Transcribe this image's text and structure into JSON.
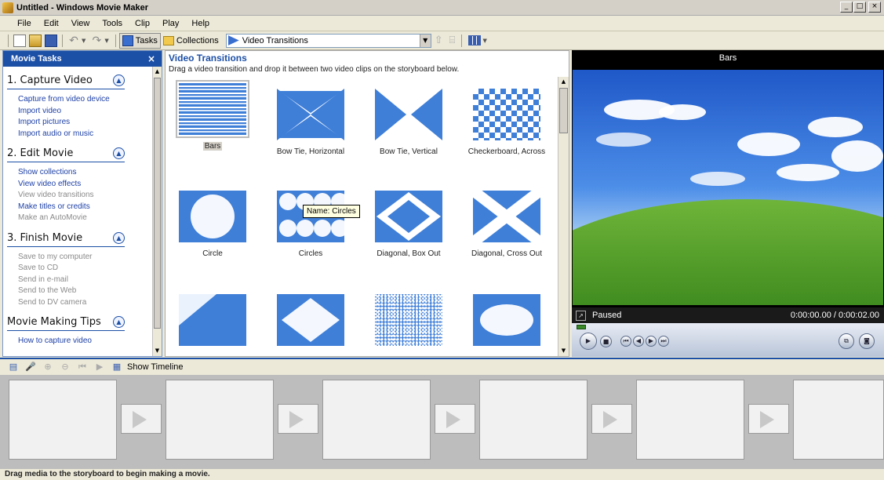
{
  "window": {
    "title": "Untitled - Windows Movie Maker",
    "minimize": "_",
    "maximize": "□",
    "close": "×"
  },
  "menu": [
    "File",
    "Edit",
    "View",
    "Tools",
    "Clip",
    "Play",
    "Help"
  ],
  "toolbar": {
    "tasks_label": "Tasks",
    "collections_label": "Collections",
    "collection_select": "Video Transitions"
  },
  "tasks": {
    "header": "Movie Tasks",
    "close": "×",
    "sections": [
      {
        "title": "1. Capture Video",
        "items": [
          {
            "label": "Capture from video device",
            "enabled": true
          },
          {
            "label": "Import video",
            "enabled": true
          },
          {
            "label": "Import pictures",
            "enabled": true
          },
          {
            "label": "Import audio or music",
            "enabled": true
          }
        ]
      },
      {
        "title": "2. Edit Movie",
        "items": [
          {
            "label": "Show collections",
            "enabled": true
          },
          {
            "label": "View video effects",
            "enabled": true
          },
          {
            "label": "View video transitions",
            "enabled": false
          },
          {
            "label": "Make titles or credits",
            "enabled": true
          },
          {
            "label": "Make an AutoMovie",
            "enabled": false
          }
        ]
      },
      {
        "title": "3. Finish Movie",
        "items": [
          {
            "label": "Save to my computer",
            "enabled": false
          },
          {
            "label": "Save to CD",
            "enabled": false
          },
          {
            "label": "Send in e-mail",
            "enabled": false
          },
          {
            "label": "Send to the Web",
            "enabled": false
          },
          {
            "label": "Send to DV camera",
            "enabled": false
          }
        ]
      },
      {
        "title": "Movie Making Tips",
        "items": [
          {
            "label": "How to capture video",
            "enabled": true
          }
        ]
      }
    ]
  },
  "content": {
    "title": "Video Transitions",
    "description": "Drag a video transition and drop it between two video clips on the storyboard below.",
    "tooltip": "Name: Circles",
    "transitions": [
      {
        "name": "Bars",
        "pattern": "bars",
        "selected": true
      },
      {
        "name": "Bow Tie, Horizontal",
        "pattern": "bowtie-h"
      },
      {
        "name": "Bow Tie, Vertical",
        "pattern": "bowtie-v"
      },
      {
        "name": "Checkerboard, Across",
        "pattern": "checker"
      },
      {
        "name": "Circle",
        "pattern": "circle"
      },
      {
        "name": "Circles",
        "pattern": "circles"
      },
      {
        "name": "Diagonal, Box Out",
        "pattern": "diamond"
      },
      {
        "name": "Diagonal, Cross Out",
        "pattern": "cross"
      },
      {
        "name": "",
        "pattern": "diag"
      },
      {
        "name": "",
        "pattern": "diamond2"
      },
      {
        "name": "",
        "pattern": "dissolve"
      },
      {
        "name": "",
        "pattern": "eye"
      }
    ]
  },
  "preview": {
    "title": "Bars",
    "status": "Paused",
    "time": "0:00:00.00 / 0:00:02.00"
  },
  "storyboard": {
    "show_timeline_label": "Show Timeline",
    "status_text": "Drag media to the storyboard to begin making a movie."
  },
  "colors": {
    "accent": "#1c4fa6",
    "transition_blue": "#3f7fd8"
  }
}
